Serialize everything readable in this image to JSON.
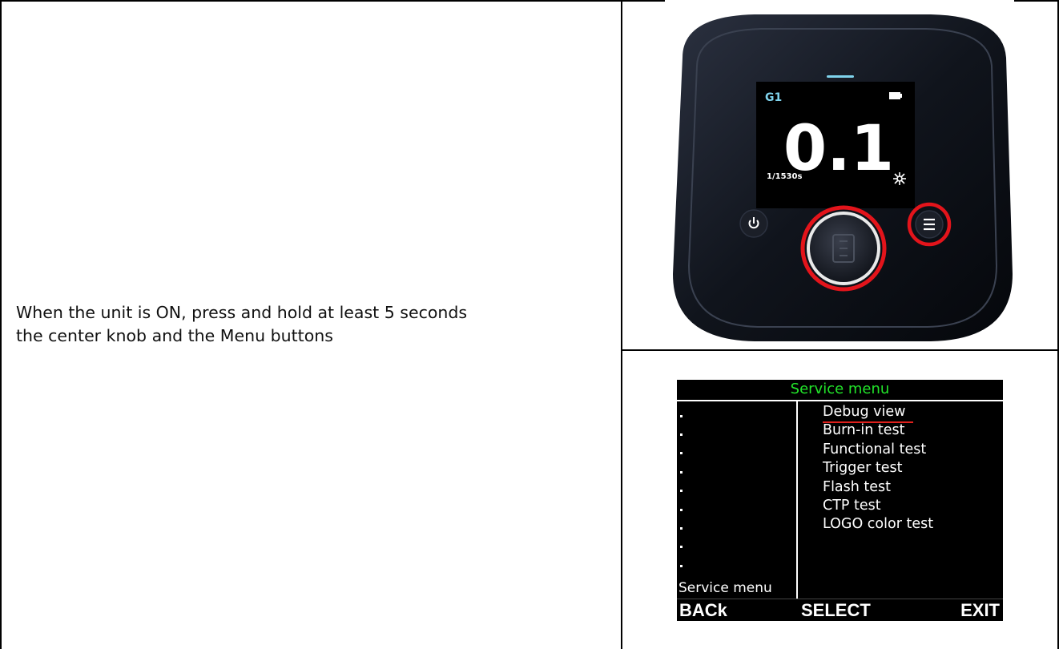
{
  "instruction": {
    "line1": "When the unit is ON, press and hold at least 5 seconds",
    "line2": "the center knob and the Menu buttons"
  },
  "device": {
    "group_label": "G1",
    "value": "0.1",
    "shutter": "1/1530s",
    "icons": [
      "battery-icon",
      "brightness-icon",
      "power-icon",
      "menu-icon",
      "center-knob-icon"
    ],
    "highlight_color": "#e3141b",
    "group_color": "#7fd3ec"
  },
  "service_screen": {
    "title": "Service menu",
    "title_color": "#22e52a",
    "items": [
      "Debug view",
      "Burn-in test",
      "Functional test",
      "Trigger test",
      "Flash test",
      "CTP test",
      "LOGO color test"
    ],
    "selected_index": 0,
    "side_label": "Service menu",
    "softkeys": {
      "back": "BACk",
      "select": "SELECT",
      "exit": "EXIT"
    }
  }
}
